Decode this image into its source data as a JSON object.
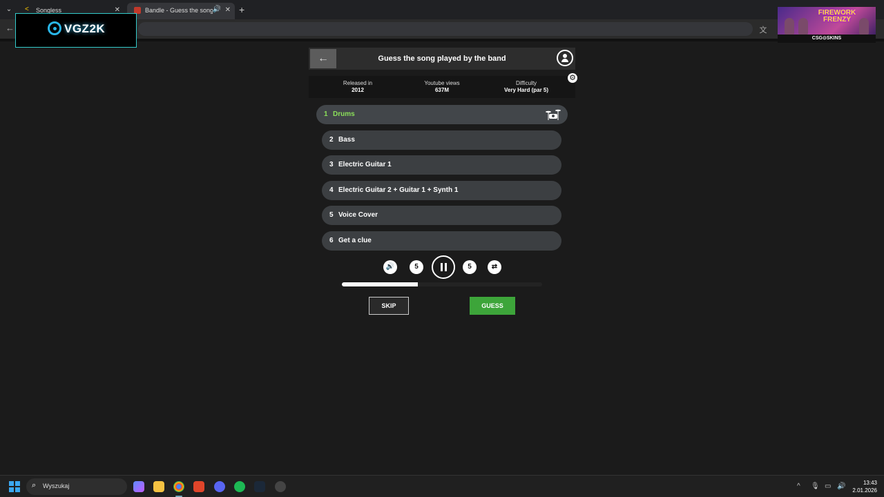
{
  "browser": {
    "tabs": [
      {
        "title": "Songless"
      },
      {
        "title": "Bandle - Guess the song, o"
      }
    ]
  },
  "overlay": {
    "logo_text": "VGZ2K"
  },
  "ad": {
    "title": "FIREWORK FRENZY",
    "brand": "CSG⊙SKINS"
  },
  "header": {
    "title": "Guess the song played by the band"
  },
  "info": [
    {
      "label": "Released in",
      "value": "2012"
    },
    {
      "label": "Youtube views",
      "value": "637M"
    },
    {
      "label": "Difficulty",
      "value": "Very Hard (par 5)"
    }
  ],
  "tracks": [
    {
      "num": "1",
      "name": "Drums",
      "active": true
    },
    {
      "num": "2",
      "name": "Bass"
    },
    {
      "num": "3",
      "name": "Electric Guitar 1"
    },
    {
      "num": "4",
      "name": "Electric Guitar 2 + Guitar 1 + Synth 1"
    },
    {
      "num": "5",
      "name": "Voice Cover"
    },
    {
      "num": "6",
      "name": "Get a clue"
    }
  ],
  "player": {
    "rewind_label": "5",
    "forward_label": "5",
    "progress": 0.38
  },
  "actions": {
    "skip_label": "SKIP",
    "guess_label": "GUESS"
  },
  "taskbar": {
    "search_placeholder": "Wyszukaj",
    "time": "13:43",
    "date": "2.01.2026"
  },
  "colors": {
    "accent_green": "#3da53a",
    "active_track_text": "#8be05a"
  }
}
